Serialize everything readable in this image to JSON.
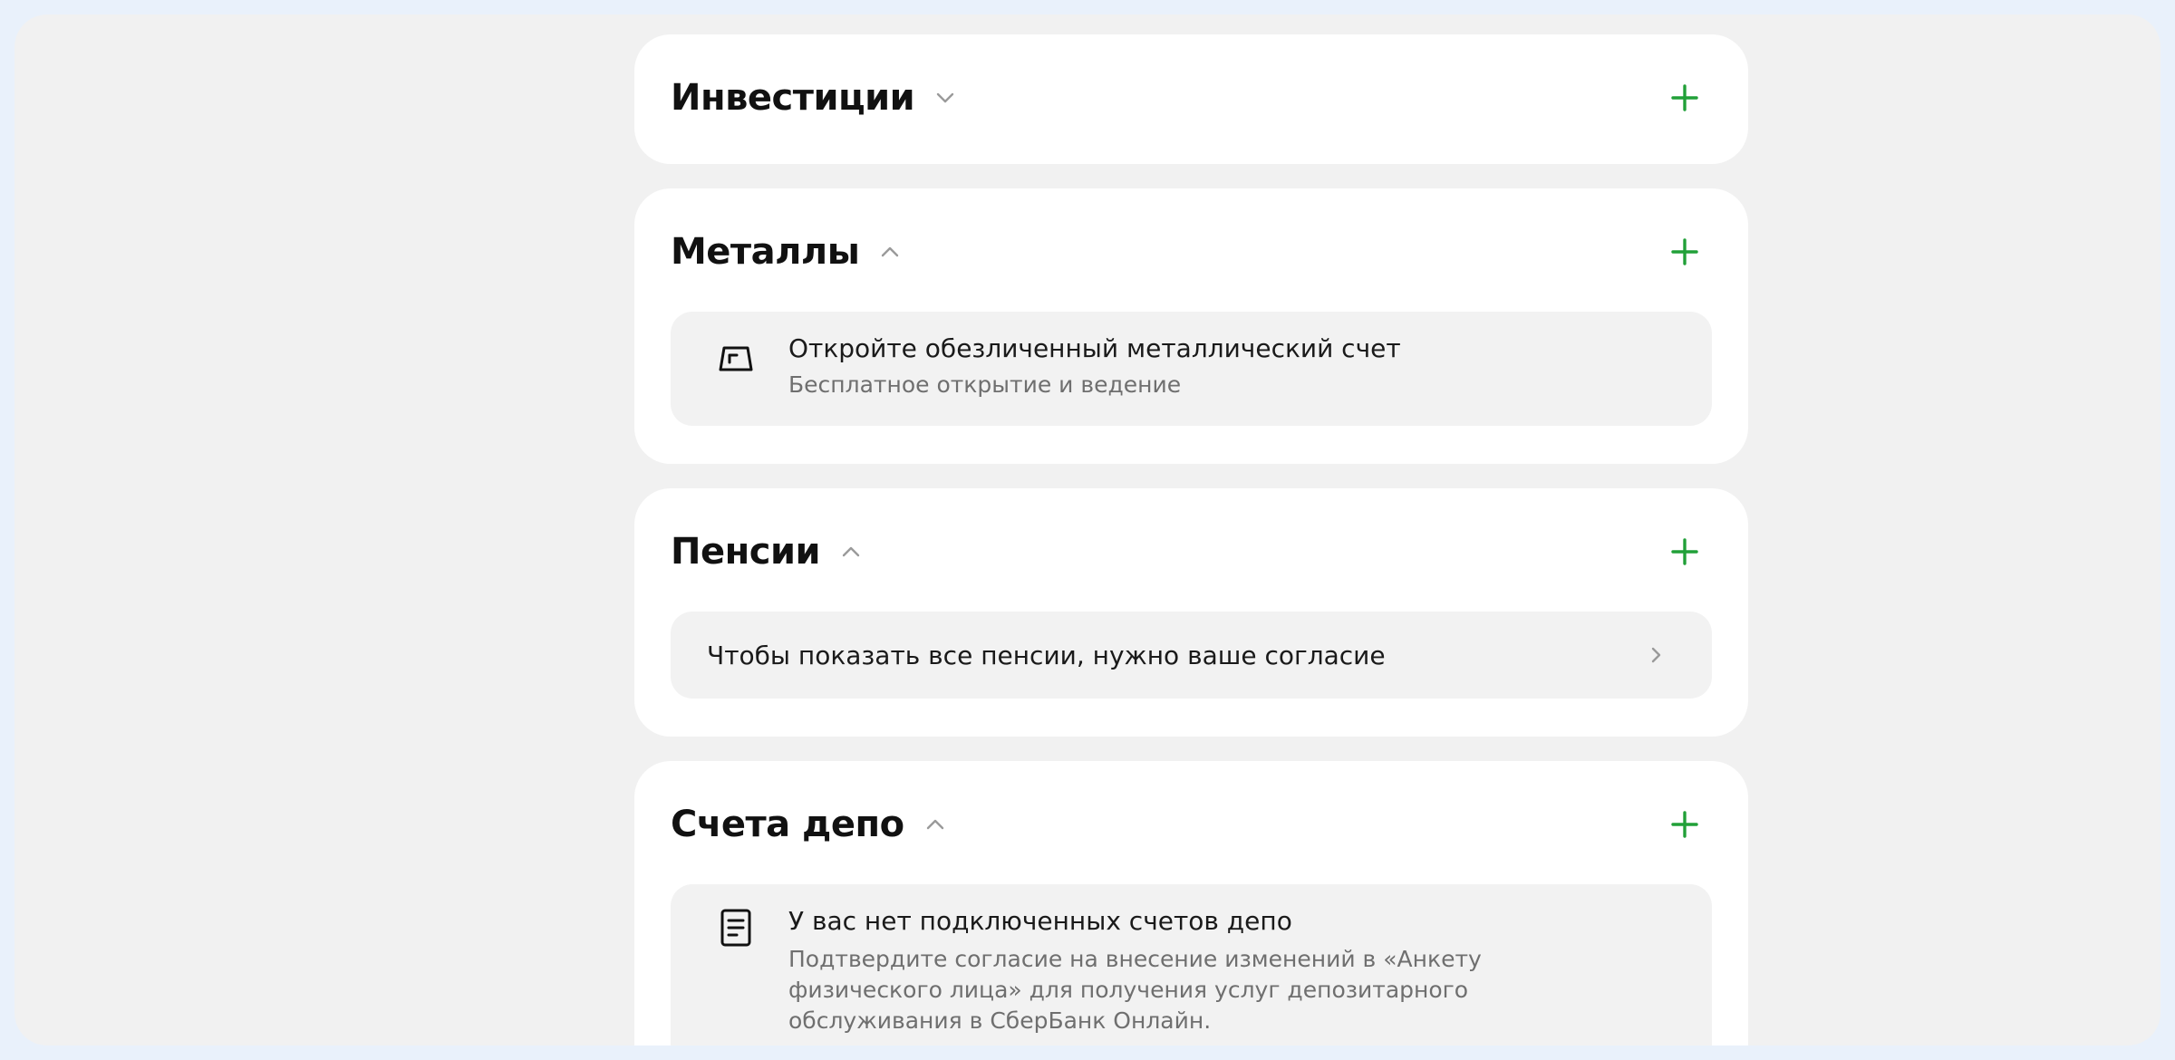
{
  "sections": {
    "investments": {
      "title": "Инвестиции"
    },
    "metals": {
      "title": "Металлы",
      "panel_title": "Откройте обезличенный металлический счет",
      "panel_subtitle": "Бесплатное открытие и ведение",
      "icon": "metal-ingot-icon"
    },
    "pensions": {
      "title": "Пенсии",
      "consent_text": "Чтобы показать все пенсии, нужно ваше согласие"
    },
    "depo": {
      "title": "Счета депо",
      "panel_title": "У вас нет подключенных счетов депо",
      "panel_subtitle": "Подтвердите согласие на внесение изменений в «Анкету физического лица» для получения услуг депозитарного обслуживания в СберБанк Онлайн.",
      "icon": "document-icon"
    }
  },
  "colors": {
    "accent_green": "#21a038",
    "page_background": "#f1f1f1",
    "card_background": "#ffffff",
    "panel_background": "#f2f2f2",
    "frame_border": "#e9f1fb"
  }
}
